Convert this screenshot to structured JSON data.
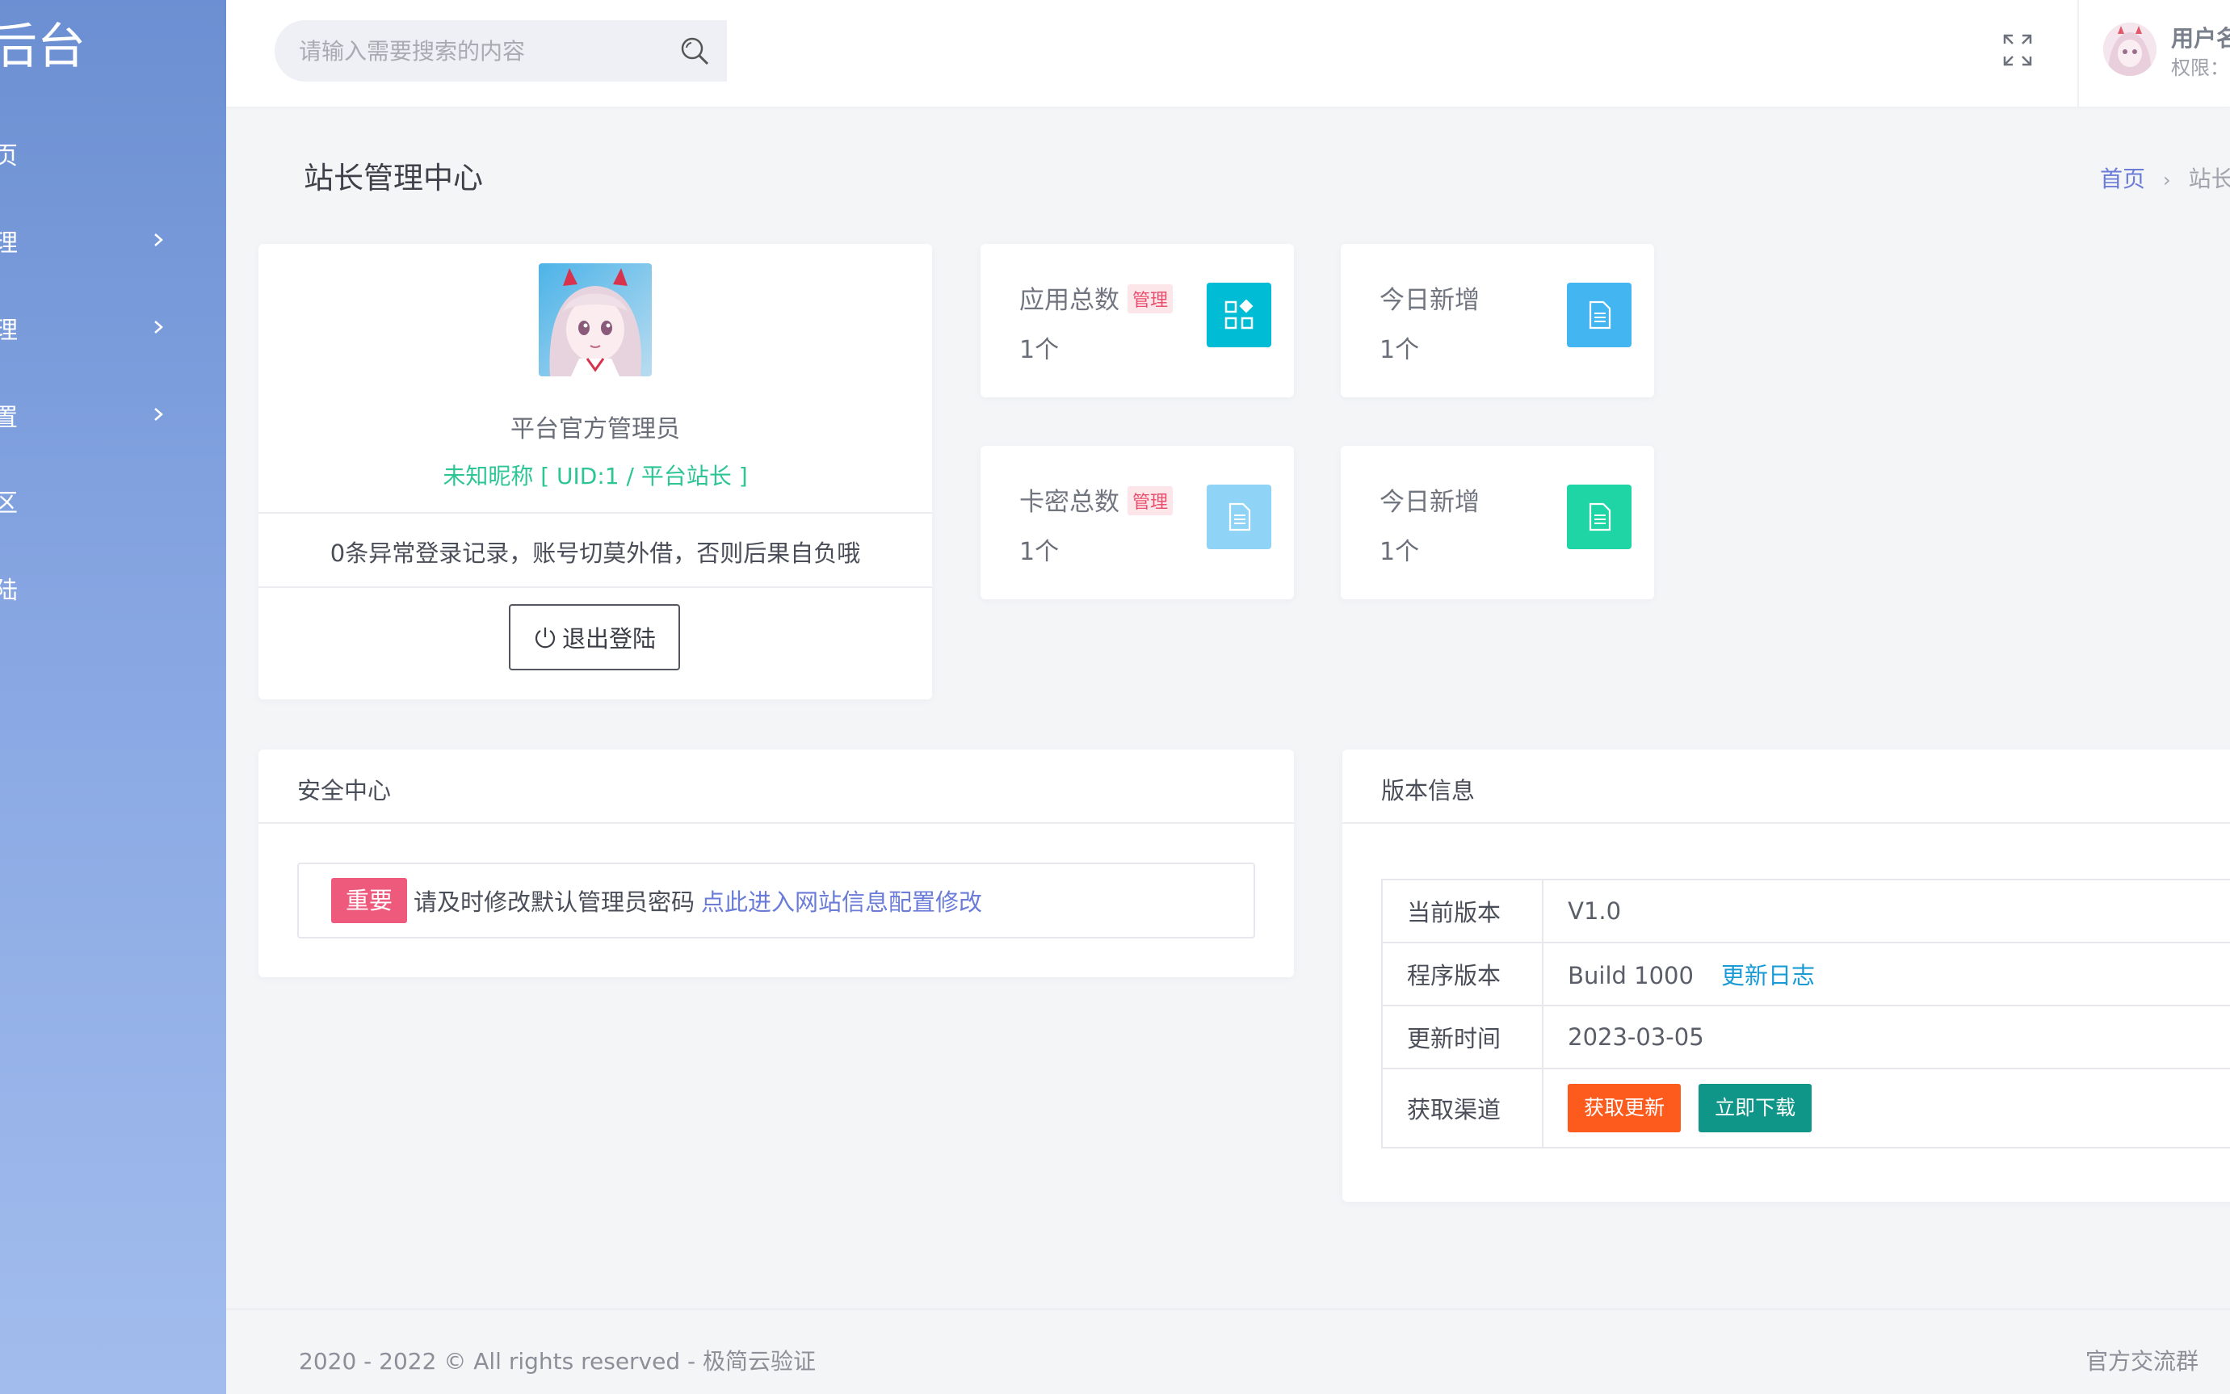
{
  "sidebar": {
    "brand": "后台",
    "items": [
      {
        "label": "页",
        "has_arrow": false
      },
      {
        "label": "理",
        "has_arrow": true
      },
      {
        "label": "理",
        "has_arrow": true
      },
      {
        "label": "置",
        "has_arrow": true
      },
      {
        "label": "区",
        "has_arrow": false
      },
      {
        "label": "陆",
        "has_arrow": false
      }
    ]
  },
  "header": {
    "search_placeholder": "请输入需要搜索的内容",
    "user_name": "用户名",
    "user_role": "权限："
  },
  "page": {
    "title": "站长管理中心",
    "breadcrumb": {
      "home": "首页",
      "current": "站长"
    }
  },
  "profile": {
    "role": "平台官方管理员",
    "nickname_line": "未知昵称 [ UID:1 / 平台站长 ]",
    "notice": "0条异常登录记录，账号切莫外借，否则后果自负哦",
    "logout_label": "退出登陆"
  },
  "stats": [
    {
      "label": "应用总数",
      "tag": "管理",
      "value": "1个",
      "icon": "apps-icon",
      "color": "#00bcd4"
    },
    {
      "label": "今日新增",
      "tag": "",
      "value": "1个",
      "icon": "document-icon",
      "color": "#43b5f1"
    },
    {
      "label": "卡密总数",
      "tag": "管理",
      "value": "1个",
      "icon": "document-icon",
      "color": "#8fd3f6"
    },
    {
      "label": "今日新增",
      "tag": "",
      "value": "1个",
      "icon": "document-icon",
      "color": "#1fd5a6"
    }
  ],
  "security": {
    "title": "安全中心",
    "badge": "重要",
    "text": "请及时修改默认管理员密码",
    "link": "点此进入网站信息配置修改"
  },
  "version": {
    "title": "版本信息",
    "rows": {
      "current": {
        "key": "当前版本",
        "value": "V1.0"
      },
      "build": {
        "key": "程序版本",
        "value": "Build 1000",
        "link": "更新日志"
      },
      "updated": {
        "key": "更新时间",
        "value": "2023-03-05"
      },
      "channel": {
        "key": "获取渠道",
        "btn_update": "获取更新",
        "btn_download": "立即下载"
      }
    }
  },
  "footer": {
    "copyright": "2020 - 2022 © All rights reserved - 极简云验证",
    "group": "官方交流群"
  },
  "colors": {
    "sidebar_top": "#6b8fd2",
    "sidebar_bottom": "#a2bced",
    "accent": "#6a7bd8",
    "nickname": "#2ec595",
    "badge": "#ee5a7c",
    "btn_update": "#fd5a1e",
    "btn_download": "#109688",
    "version_link": "#1a9bd6"
  }
}
